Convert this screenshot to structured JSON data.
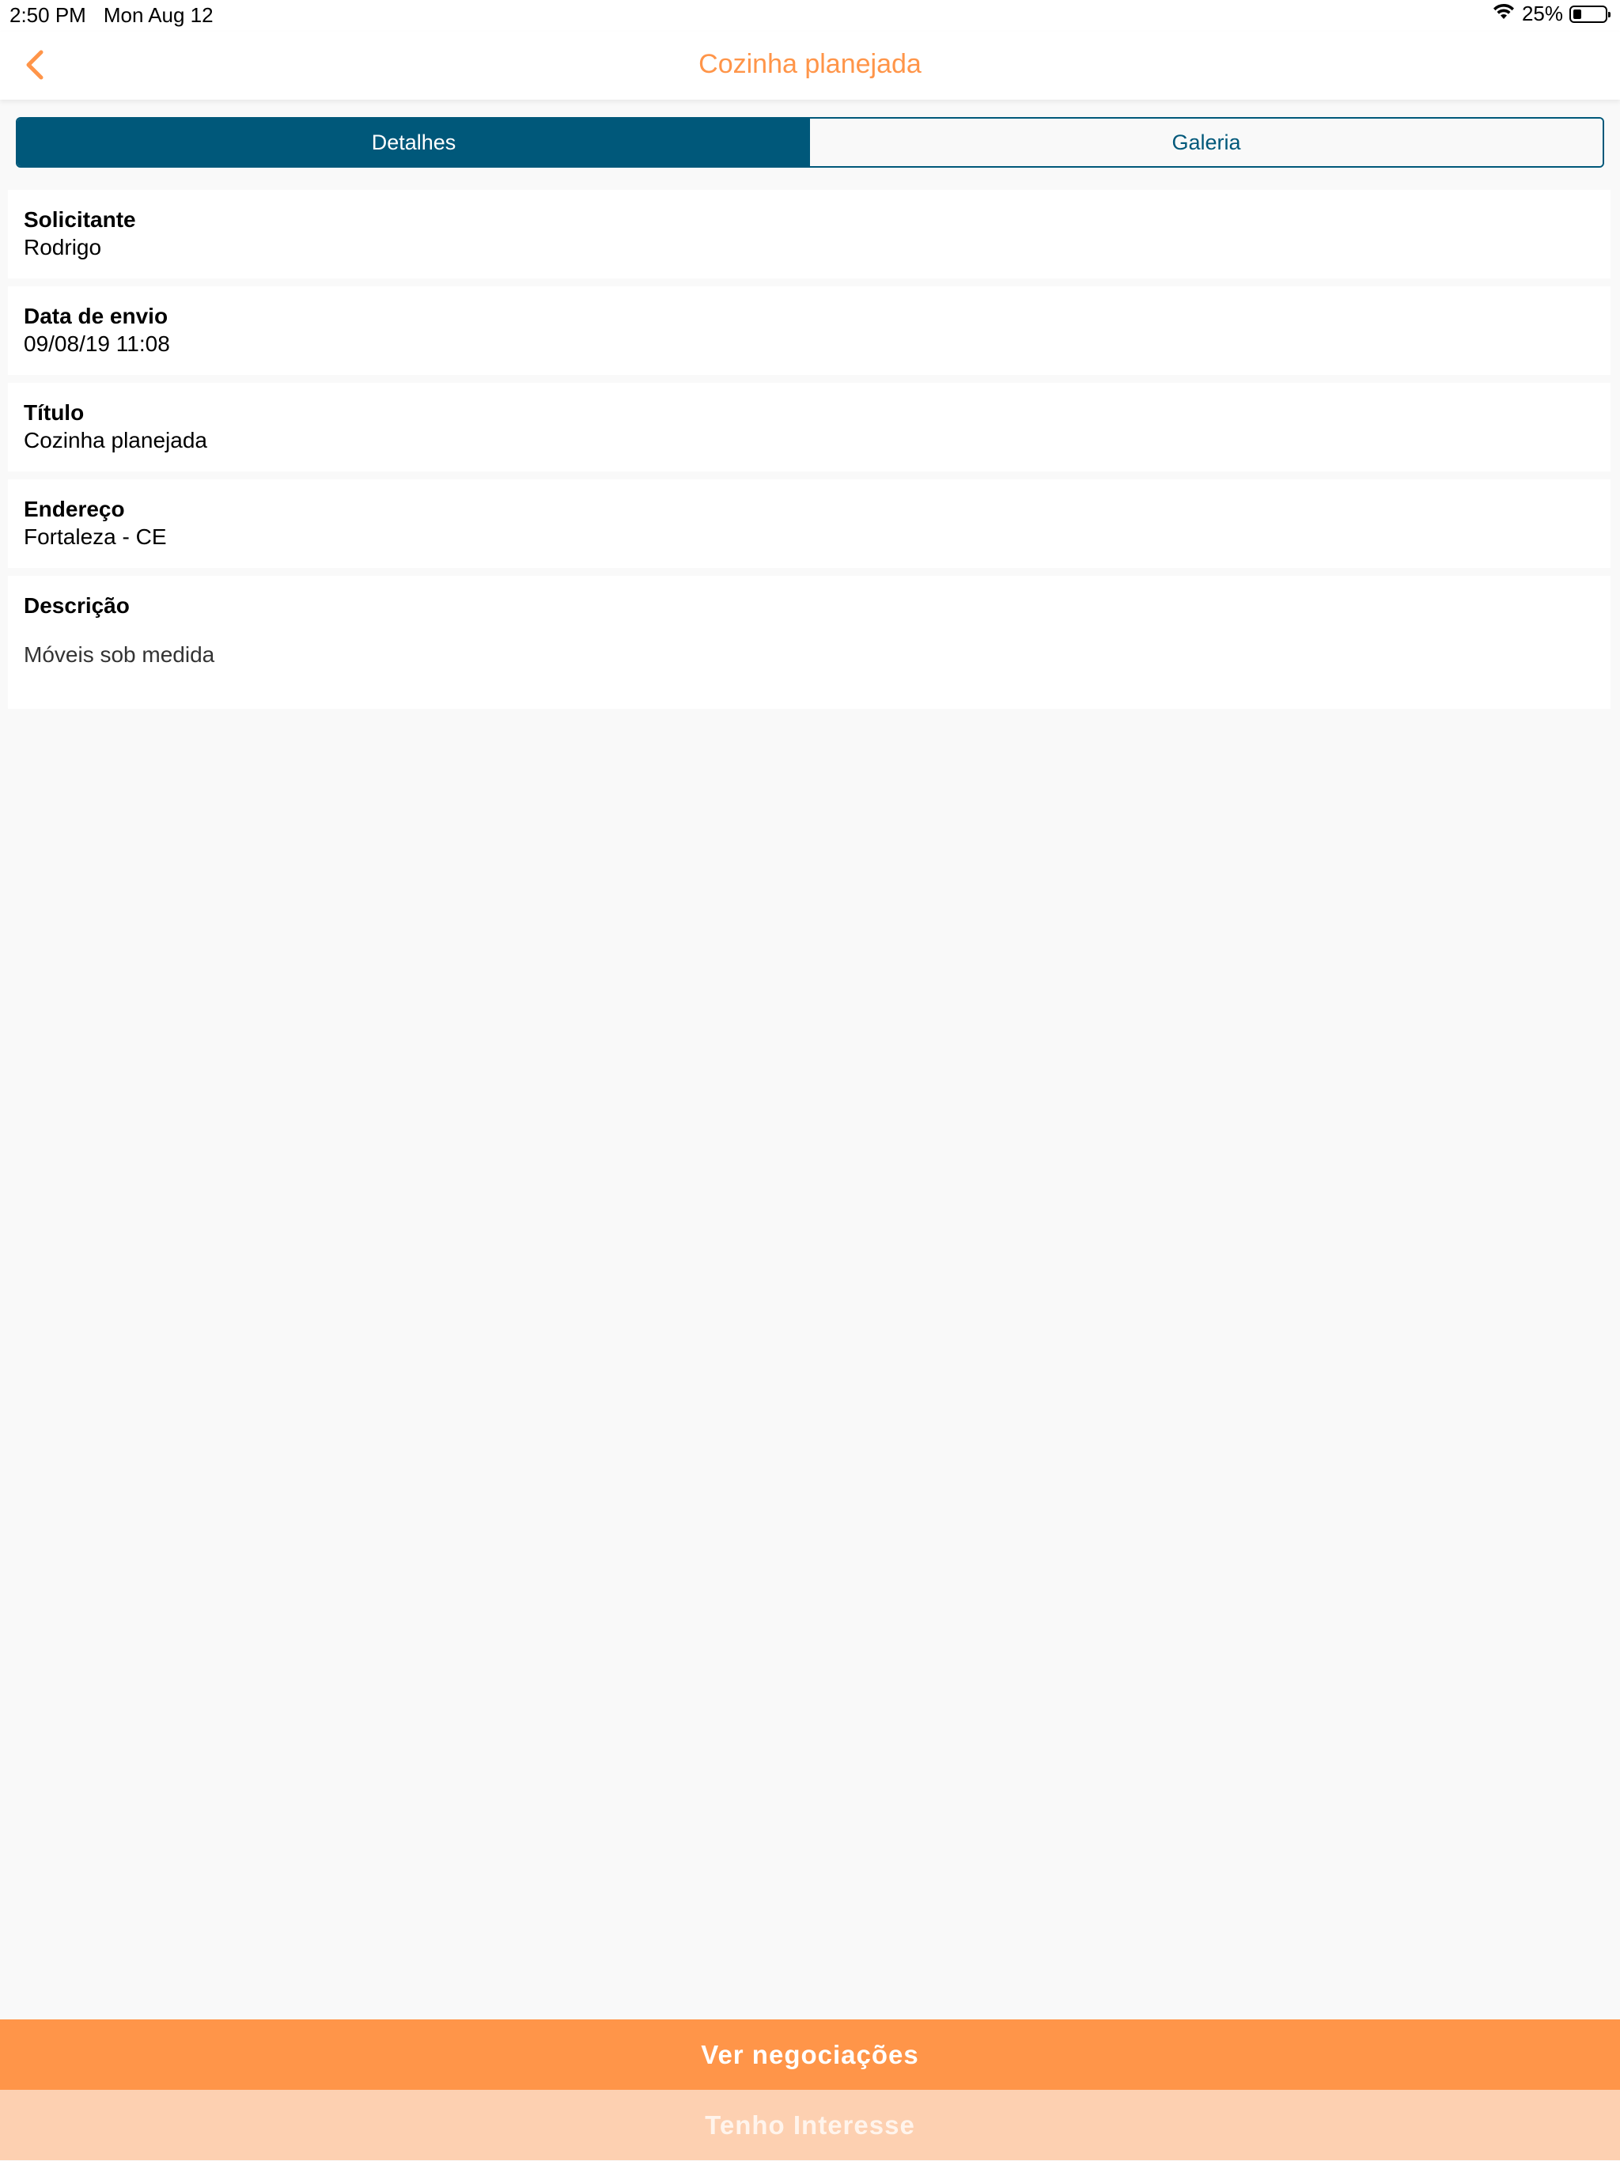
{
  "status_bar": {
    "time": "2:50 PM",
    "date": "Mon Aug 12",
    "battery_text": "25%",
    "battery_level": 0.25
  },
  "nav": {
    "title": "Cozinha planejada",
    "back_icon": "chevron-left-icon"
  },
  "tabs": [
    {
      "label": "Detalhes",
      "active": true
    },
    {
      "label": "Galeria",
      "active": false
    }
  ],
  "details": [
    {
      "label": "Solicitante",
      "value": "Rodrigo"
    },
    {
      "label": "Data de envio",
      "value": "09/08/19 11:08"
    },
    {
      "label": "Título",
      "value": "Cozinha planejada"
    },
    {
      "label": "Endereço",
      "value": "Fortaleza - CE"
    }
  ],
  "description": {
    "label": "Descrição",
    "value": "Móveis sob medida"
  },
  "actions": {
    "primary_label": "Ver negociações",
    "secondary_label": "Tenho Interesse"
  },
  "colors": {
    "accent": "#ff9549",
    "segment": "#00587a",
    "disabled": "#fdd0b1"
  }
}
